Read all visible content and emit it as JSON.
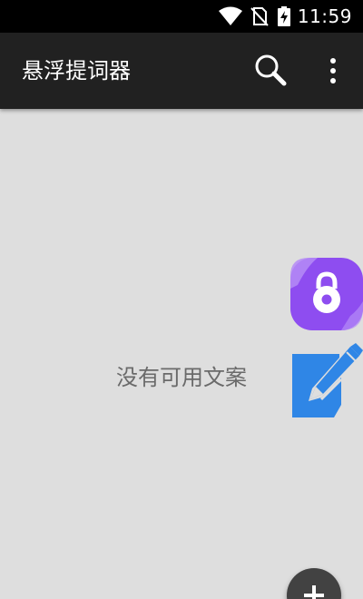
{
  "status_bar": {
    "time": "11:59",
    "icons": [
      "wifi-icon",
      "no-sim-icon",
      "battery-charging-icon"
    ]
  },
  "app_bar": {
    "title": "悬浮提词器",
    "actions": [
      "search-icon",
      "more-vert-icon"
    ]
  },
  "main": {
    "empty_message": "没有可用文案"
  },
  "floating_widgets": [
    "lock-icon",
    "edit-icon"
  ],
  "fab": {
    "icon": "plus-icon"
  },
  "colors": {
    "app_bar": "#212121",
    "status_bar": "#000000",
    "background": "#dedede",
    "lock_widget": "#8e4df0",
    "edit_widget": "#2f86e6",
    "fab": "#424242"
  }
}
